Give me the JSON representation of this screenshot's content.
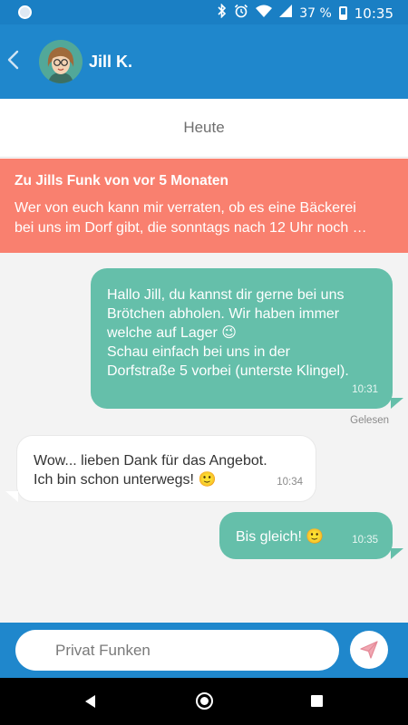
{
  "status_bar": {
    "battery_text": "37 %",
    "battery_level": 0.37,
    "time": "10:35"
  },
  "header": {
    "contact_name": "Jill K."
  },
  "date_separator": "Heute",
  "quote": {
    "title": "Zu Jills Funk von vor 5 Monaten",
    "text": "Wer von euch kann mir verraten, ob es eine Bäckerei\nbei uns im Dorf gibt, die sonntags nach 12 Uhr noch …"
  },
  "messages": [
    {
      "direction": "outgoing",
      "text": "Hallo Jill, du kannst dir gerne bei uns\nBrötchen abholen. Wir haben immer\nwelche auf Lager 😉\nSchau einfach bei uns in der\nDorfstraße 5 vorbei (unterste Klingel).",
      "time": "10:31",
      "status": "Gelesen"
    },
    {
      "direction": "incoming",
      "text": "Wow... lieben Dank für das Angebot.\nIch bin schon unterwegs! 🙂",
      "time": "10:34"
    },
    {
      "direction": "outgoing",
      "text": "Bis gleich! 🙂",
      "time": "10:35"
    }
  ],
  "composer": {
    "placeholder": "Privat Funken",
    "value": ""
  },
  "icons": {
    "back": "chevron-left-icon",
    "send": "paper-plane-icon",
    "bluetooth": "bluetooth-icon",
    "alarm": "alarm-icon",
    "wifi": "wifi-icon",
    "signal": "signal-icon"
  },
  "colors": {
    "app_bar": "#1f87cc",
    "outgoing_bubble": "#65bfaa",
    "quote_banner": "#f9806f",
    "send_icon": "#e58a98"
  }
}
